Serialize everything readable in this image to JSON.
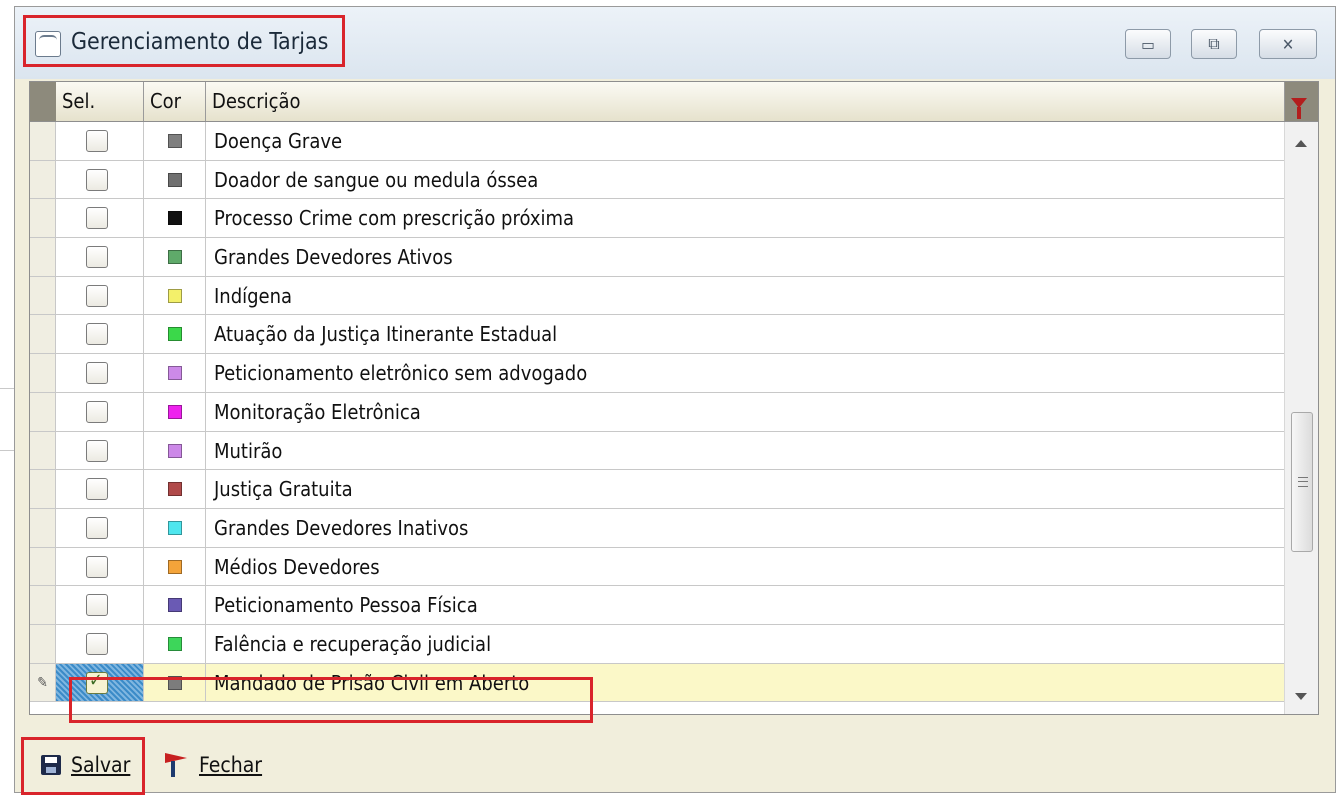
{
  "window": {
    "title": "Gerenciamento de Tarjas",
    "controls": {
      "minimize": "▭",
      "maximize": "⧉",
      "close": "✕"
    }
  },
  "grid": {
    "columns": {
      "sel": "Sel.",
      "cor": "Cor",
      "descricao": "Descrição"
    },
    "rows": [
      {
        "selected": false,
        "color": "#7f7f7f",
        "descricao": "Doença Grave"
      },
      {
        "selected": false,
        "color": "#707070",
        "descricao": "Doador de sangue ou medula óssea"
      },
      {
        "selected": false,
        "color": "#111111",
        "descricao": "Processo Crime com prescrição próxima"
      },
      {
        "selected": false,
        "color": "#5faa6a",
        "descricao": "Grandes Devedores Ativos"
      },
      {
        "selected": false,
        "color": "#f3f06a",
        "descricao": "Indígena"
      },
      {
        "selected": false,
        "color": "#3bd84a",
        "descricao": "Atuação da  Justiça Itinerante Estadual"
      },
      {
        "selected": false,
        "color": "#cc8ae8",
        "descricao": "Peticionamento eletrônico sem advogado"
      },
      {
        "selected": false,
        "color": "#ee22ee",
        "descricao": "Monitoração Eletrônica"
      },
      {
        "selected": false,
        "color": "#cc88e8",
        "descricao": "Mutirão"
      },
      {
        "selected": false,
        "color": "#b04a4a",
        "descricao": "Justiça Gratuita"
      },
      {
        "selected": false,
        "color": "#4fe6ee",
        "descricao": "Grandes Devedores Inativos"
      },
      {
        "selected": false,
        "color": "#f4a43a",
        "descricao": "Médios Devedores"
      },
      {
        "selected": false,
        "color": "#6a5ab4",
        "descricao": "Peticionamento Pessoa Física"
      },
      {
        "selected": false,
        "color": "#3dd65a",
        "descricao": "Falência e recuperação judicial"
      },
      {
        "selected": true,
        "color": "#7c7c7c",
        "descricao": "Mandado de Prisão Civil em Aberto"
      }
    ],
    "active_row_marker": "✎"
  },
  "toolbar": {
    "save_label": "Salvar",
    "close_label": "Fechar"
  }
}
